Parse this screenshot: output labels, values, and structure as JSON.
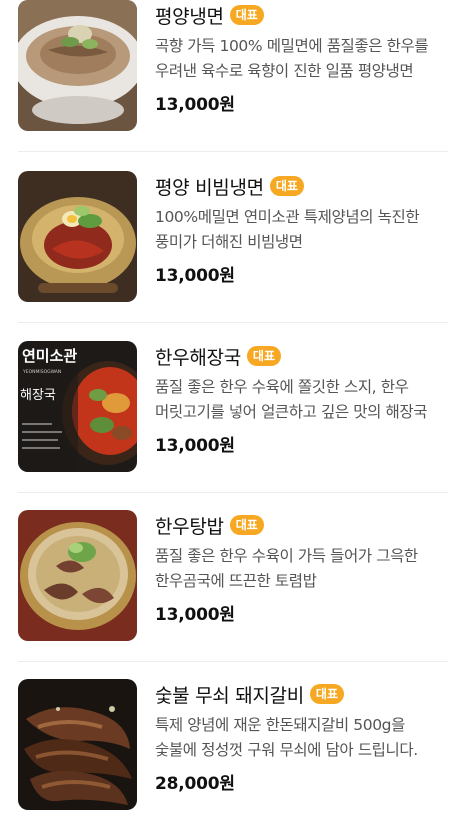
{
  "menu": {
    "items": [
      {
        "name": "평양냉면",
        "badge": "대표",
        "description": "곡향 가득 100% 메밀면에 품질좋은 한우를 우려낸 육수로 육향이 진한 일품 평양냉면",
        "price": "13,000원",
        "image_icon": "naengmyeon-photo"
      },
      {
        "name": "평양 비빔냉면",
        "badge": "대표",
        "description": "100%메밀면 연미소관 특제양념의 녹진한 풍미가 더해진 비빔냉면",
        "price": "13,000원",
        "image_icon": "bibim-naengmyeon-photo"
      },
      {
        "name": "한우해장국",
        "badge": "대표",
        "description": "품질 좋은 한우 수육에 쫄깃한 스지, 한우 머릿고기를 넣어 얼큰하고 깊은 맛의 해장국",
        "price": "13,000원",
        "image_icon": "haejangguk-photo",
        "image_text": {
          "brand": "연미소관",
          "brand_sub": "YEONMISOGWAN",
          "label": "해장국"
        }
      },
      {
        "name": "한우탕밥",
        "badge": "대표",
        "description": "품질 좋은 한우 수육이 가득 들어가 그윽한 한우곰국에 뜨끈한 토렴밥",
        "price": "13,000원",
        "image_icon": "tangbap-photo"
      },
      {
        "name": "숯불 무쇠 돼지갈비",
        "badge": "대표",
        "description": "특제 양념에 재운 한돈돼지갈비 500g을 숯불에 정성껏 구워 무쇠에 담아 드립니다.",
        "price": "28,000원",
        "image_icon": "pork-galbi-photo"
      }
    ]
  },
  "colors": {
    "badge": "#f7a823",
    "description": "#555555",
    "divider": "#ececec"
  }
}
